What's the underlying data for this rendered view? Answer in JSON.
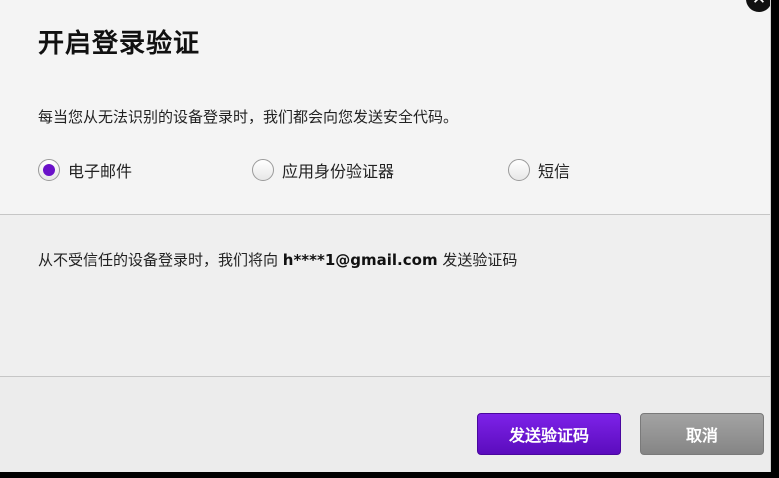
{
  "dialog": {
    "title": "开启登录验证",
    "close_glyph": "✕",
    "description": "每当您从无法识别的设备登录时，我们都会向您发送安全代码。",
    "options": [
      {
        "label": "电子邮件",
        "selected": true
      },
      {
        "label": "应用身份验证器",
        "selected": false
      },
      {
        "label": "短信",
        "selected": false
      }
    ],
    "info_prefix": "从不受信任的设备登录时，我们将向 ",
    "info_email": "h****1@gmail.com",
    "info_suffix": " 发送验证码",
    "send_button_label": "发送验证码",
    "cancel_button_label": "取消"
  },
  "colors": {
    "accent": "#6a11c9",
    "cancel_gray": "#959595"
  }
}
